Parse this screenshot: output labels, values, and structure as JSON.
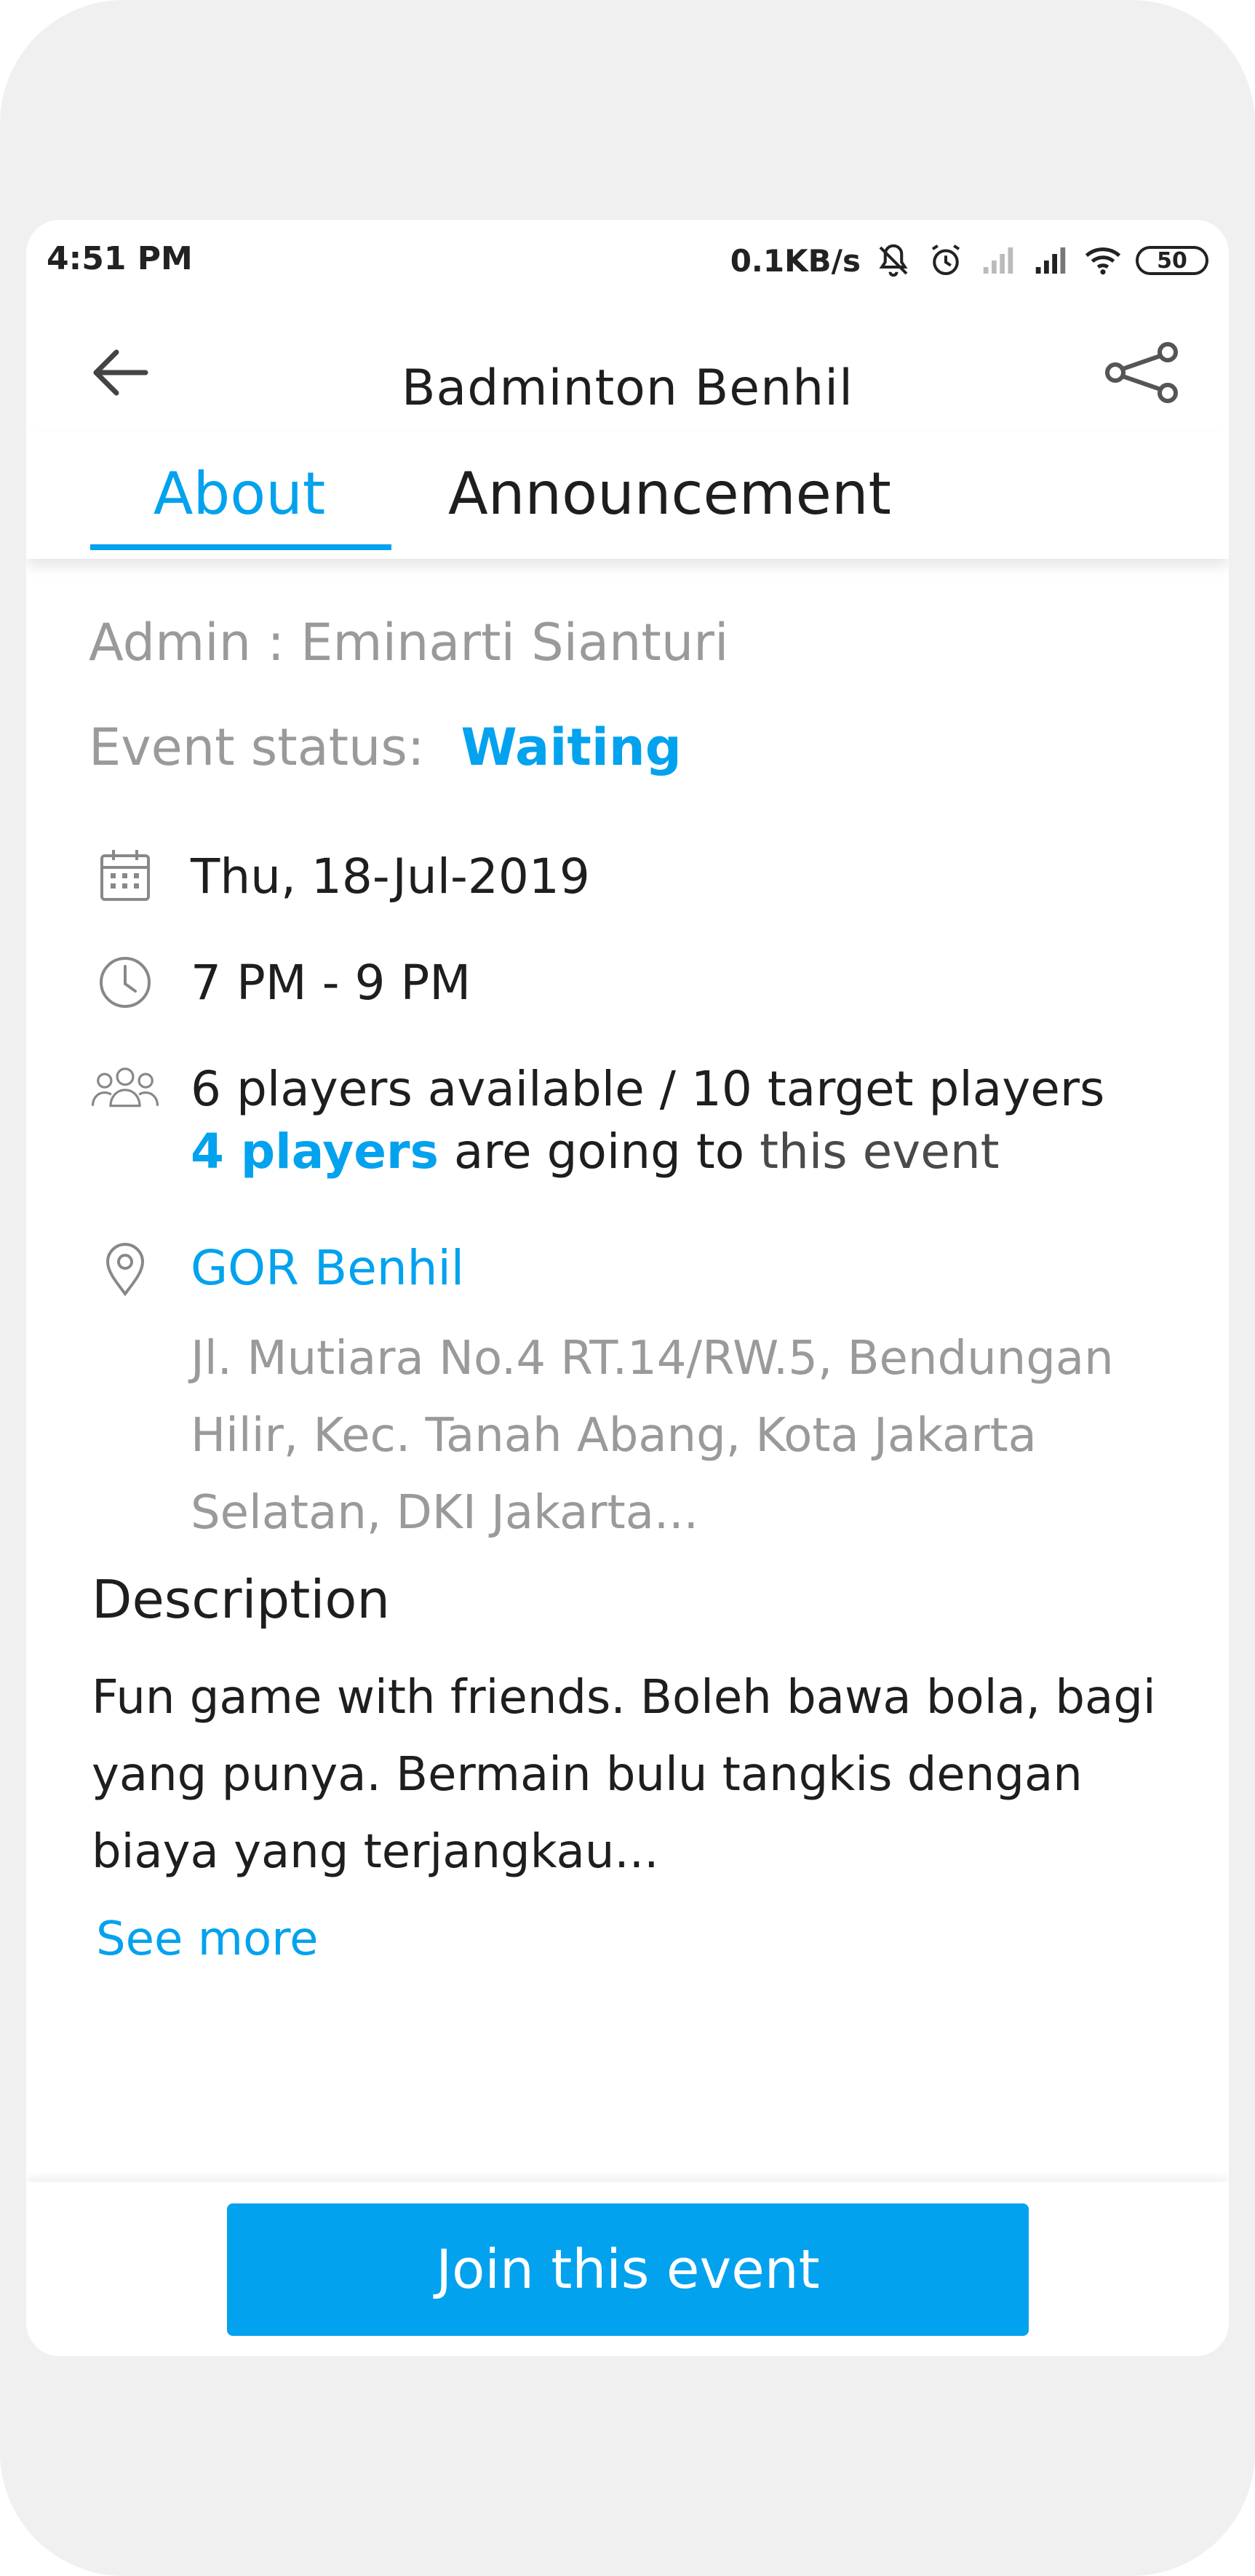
{
  "status_bar": {
    "time": "4:51 PM",
    "network_speed": "0.1KB/s",
    "battery": "50",
    "icons": [
      "bell-off-icon",
      "alarm-icon",
      "signal-weak-icon",
      "signal-icon",
      "wifi-icon",
      "battery-icon"
    ]
  },
  "header": {
    "title": "Badminton Benhil",
    "back_icon": "arrow-left-icon",
    "share_icon": "share-icon"
  },
  "tabs": [
    {
      "label": "About",
      "active": true
    },
    {
      "label": "Announcement",
      "active": false
    }
  ],
  "about": {
    "admin": "Admin : Eminarti Sianturi",
    "status_label": "Event status:",
    "status_value": "Waiting",
    "date": "Thu, 18-Jul-2019",
    "time_range": "7 PM - 9 PM",
    "players": "6 players available / 10 target players",
    "going_highlight": "4 players",
    "going_mid": " are going to",
    "going_end": " this event",
    "venue_name": "GOR Benhil",
    "venue_address": "Jl. Mutiara No.4 RT.14/RW.5, Bendungan Hilir, Kec. Tanah Abang, Kota Jakarta Selatan, DKI Jakarta..."
  },
  "description": {
    "title": "Description",
    "body": "Fun game with friends. Boleh bawa bola, bagi yang punya. Bermain bulu tangkis dengan biaya yang terjangkau...",
    "see_more": "See more"
  },
  "footer": {
    "join_label": "Join this event"
  },
  "colors": {
    "accent": "#03a2ee",
    "text": "#1e1e1e",
    "muted": "#9a9a9a"
  }
}
